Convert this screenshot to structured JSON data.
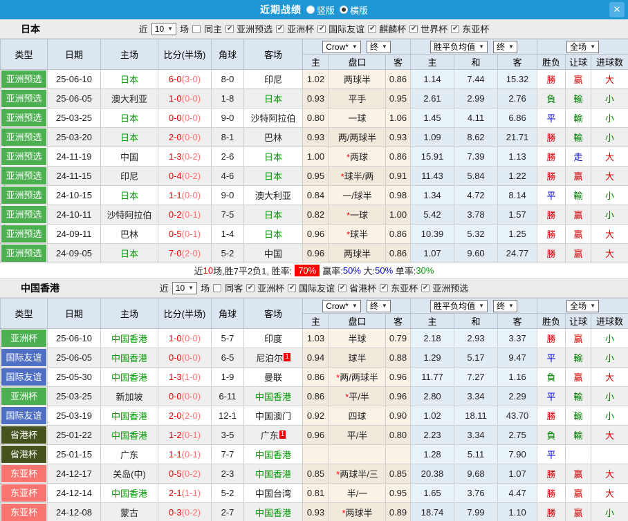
{
  "colors": {
    "titlebar": "#1e97d4",
    "badge_green": "#4cb050",
    "badge_blue": "#4e6fc4",
    "badge_olive": "#47531e",
    "badge_salmon": "#fa7470",
    "team_green": "#009900",
    "score_red": "#e60000",
    "half_red": "#ff7373",
    "win": "#d40000",
    "lose": "#008000",
    "draw": "#0000cc",
    "summary_highlight": "#ff0000"
  },
  "titlebar": {
    "title": "近期战绩",
    "vertical_label": "竖版",
    "horizontal_label": "横版",
    "close_glyph": "✕"
  },
  "controls": {
    "near": "近",
    "matches": "场"
  },
  "table_header": {
    "type": "类型",
    "date": "日期",
    "home": "主场",
    "score": "比分(半场)",
    "corner": "角球",
    "away": "客场",
    "crow_label": "Crow*",
    "final_label": "终",
    "avg_label": "胜平负均值",
    "fullmatch_label": "全场",
    "sub": [
      "主",
      "盘口",
      "客",
      "主",
      "和",
      "客",
      "胜负",
      "让球",
      "进球数"
    ]
  },
  "sections": [
    {
      "team": "日本",
      "count": "10",
      "same_label": "同主",
      "same_checked": false,
      "competitions": [
        "亚洲预选",
        "亚洲杯",
        "国际友谊",
        "麒麟杯",
        "世界杯",
        "东亚杯"
      ],
      "rows": [
        {
          "type": "亚洲预选",
          "tc": "g",
          "date": "25-06-10",
          "home": "日本",
          "hg": 1,
          "score": "6-0",
          "half": "(3-0)",
          "corner": "8-0",
          "away": "印尼",
          "ag": 0,
          "sup": "",
          "o1": "1.02",
          "hc": "两球半",
          "o2": "0.86",
          "m1": "1.14",
          "m2": "7.44",
          "m3": "15.32",
          "r1": "勝",
          "r2": "赢",
          "r3": "大"
        },
        {
          "type": "亚洲预选",
          "tc": "g",
          "date": "25-06-05",
          "home": "澳大利亚",
          "hg": 0,
          "score": "1-0",
          "half": "(0-0)",
          "corner": "1-8",
          "away": "日本",
          "ag": 1,
          "sup": "",
          "o1": "0.93",
          "hc": "平手",
          "o2": "0.95",
          "m1": "2.61",
          "m2": "2.99",
          "m3": "2.76",
          "r1": "負",
          "r2": "輸",
          "r3": "小"
        },
        {
          "type": "亚洲预选",
          "tc": "g",
          "date": "25-03-25",
          "home": "日本",
          "hg": 1,
          "score": "0-0",
          "half": "(0-0)",
          "corner": "9-0",
          "away": "沙特阿拉伯",
          "ag": 0,
          "sup": "",
          "o1": "0.80",
          "hc": "一球",
          "o2": "1.06",
          "m1": "1.45",
          "m2": "4.11",
          "m3": "6.86",
          "r1": "平",
          "r2": "輸",
          "r3": "小"
        },
        {
          "type": "亚洲预选",
          "tc": "g",
          "date": "25-03-20",
          "home": "日本",
          "hg": 1,
          "score": "2-0",
          "half": "(0-0)",
          "corner": "8-1",
          "away": "巴林",
          "ag": 0,
          "sup": "",
          "o1": "0.93",
          "hc": "两/两球半",
          "o2": "0.93",
          "m1": "1.09",
          "m2": "8.62",
          "m3": "21.71",
          "r1": "勝",
          "r2": "輸",
          "r3": "小"
        },
        {
          "type": "亚洲预选",
          "tc": "g",
          "date": "24-11-19",
          "home": "中国",
          "hg": 0,
          "score": "1-3",
          "half": "(0-2)",
          "corner": "2-6",
          "away": "日本",
          "ag": 1,
          "sup": "",
          "o1": "1.00",
          "hc": "*两球",
          "o2": "0.86",
          "m1": "15.91",
          "m2": "7.39",
          "m3": "1.13",
          "r1": "勝",
          "r2": "走",
          "r3": "大"
        },
        {
          "type": "亚洲预选",
          "tc": "g",
          "date": "24-11-15",
          "home": "印尼",
          "hg": 0,
          "score": "0-4",
          "half": "(0-2)",
          "corner": "4-6",
          "away": "日本",
          "ag": 1,
          "sup": "",
          "o1": "0.95",
          "hc": "*球半/两",
          "o2": "0.91",
          "m1": "11.43",
          "m2": "5.84",
          "m3": "1.22",
          "r1": "勝",
          "r2": "赢",
          "r3": "大"
        },
        {
          "type": "亚洲预选",
          "tc": "g",
          "date": "24-10-15",
          "home": "日本",
          "hg": 1,
          "score": "1-1",
          "half": "(0-0)",
          "corner": "9-0",
          "away": "澳大利亚",
          "ag": 0,
          "sup": "",
          "o1": "0.84",
          "hc": "一/球半",
          "o2": "0.98",
          "m1": "1.34",
          "m2": "4.72",
          "m3": "8.14",
          "r1": "平",
          "r2": "輸",
          "r3": "小"
        },
        {
          "type": "亚洲预选",
          "tc": "g",
          "date": "24-10-11",
          "home": "沙特阿拉伯",
          "hg": 0,
          "score": "0-2",
          "half": "(0-1)",
          "corner": "7-5",
          "away": "日本",
          "ag": 1,
          "sup": "",
          "o1": "0.82",
          "hc": "*一球",
          "o2": "1.00",
          "m1": "5.42",
          "m2": "3.78",
          "m3": "1.57",
          "r1": "勝",
          "r2": "赢",
          "r3": "小"
        },
        {
          "type": "亚洲预选",
          "tc": "g",
          "date": "24-09-11",
          "home": "巴林",
          "hg": 0,
          "score": "0-5",
          "half": "(0-1)",
          "corner": "1-4",
          "away": "日本",
          "ag": 1,
          "sup": "",
          "o1": "0.96",
          "hc": "*球半",
          "o2": "0.86",
          "m1": "10.39",
          "m2": "5.32",
          "m3": "1.25",
          "r1": "勝",
          "r2": "赢",
          "r3": "大"
        },
        {
          "type": "亚洲预选",
          "tc": "g",
          "date": "24-09-05",
          "home": "日本",
          "hg": 1,
          "score": "7-0",
          "half": "(2-0)",
          "corner": "5-2",
          "away": "中国",
          "ag": 0,
          "sup": "",
          "o1": "0.96",
          "hc": "两球半",
          "o2": "0.86",
          "m1": "1.07",
          "m2": "9.60",
          "m3": "24.77",
          "r1": "勝",
          "r2": "赢",
          "r3": "大"
        }
      ],
      "summary": [
        {
          "t": "近",
          "c": ""
        },
        {
          "t": "10",
          "c": "r"
        },
        {
          "t": "场,胜7平2负1, 胜率:",
          "c": ""
        },
        {
          "t": "70%",
          "c": "hl"
        },
        {
          "t": "赢率:",
          "c": ""
        },
        {
          "t": "50%",
          "c": "b"
        },
        {
          "t": " 大:",
          "c": ""
        },
        {
          "t": "50%",
          "c": "b"
        },
        {
          "t": " 单率:",
          "c": ""
        },
        {
          "t": "30%",
          "c": "g"
        }
      ]
    },
    {
      "team": "中国香港",
      "count": "10",
      "same_label": "同客",
      "same_checked": false,
      "competitions": [
        "亚洲杯",
        "国际友谊",
        "省港杯",
        "东亚杯",
        "亚洲预选"
      ],
      "rows": [
        {
          "type": "亚洲杯",
          "tc": "g",
          "date": "25-06-10",
          "home": "中国香港",
          "hg": 1,
          "score": "1-0",
          "half": "(0-0)",
          "corner": "5-7",
          "away": "印度",
          "ag": 0,
          "sup": "",
          "o1": "1.03",
          "hc": "半球",
          "o2": "0.79",
          "m1": "2.18",
          "m2": "2.93",
          "m3": "3.37",
          "r1": "勝",
          "r2": "赢",
          "r3": "小"
        },
        {
          "type": "国际友谊",
          "tc": "b",
          "date": "25-06-05",
          "home": "中国香港",
          "hg": 1,
          "score": "0-0",
          "half": "(0-0)",
          "corner": "6-5",
          "away": "尼泊尔",
          "ag": 0,
          "sup": "1",
          "o1": "0.94",
          "hc": "球半",
          "o2": "0.88",
          "m1": "1.29",
          "m2": "5.17",
          "m3": "9.47",
          "r1": "平",
          "r2": "輸",
          "r3": "小"
        },
        {
          "type": "国际友谊",
          "tc": "b",
          "date": "25-05-30",
          "home": "中国香港",
          "hg": 1,
          "score": "1-3",
          "half": "(1-0)",
          "corner": "1-9",
          "away": "曼联",
          "ag": 0,
          "sup": "",
          "o1": "0.86",
          "hc": "*两/两球半",
          "o2": "0.96",
          "m1": "11.77",
          "m2": "7.27",
          "m3": "1.16",
          "r1": "負",
          "r2": "赢",
          "r3": "大"
        },
        {
          "type": "亚洲杯",
          "tc": "g",
          "date": "25-03-25",
          "home": "新加坡",
          "hg": 0,
          "score": "0-0",
          "half": "(0-0)",
          "corner": "6-11",
          "away": "中国香港",
          "ag": 1,
          "sup": "",
          "o1": "0.86",
          "hc": "*平/半",
          "o2": "0.96",
          "m1": "2.80",
          "m2": "3.34",
          "m3": "2.29",
          "r1": "平",
          "r2": "輸",
          "r3": "小"
        },
        {
          "type": "国际友谊",
          "tc": "b",
          "date": "25-03-19",
          "home": "中国香港",
          "hg": 1,
          "score": "2-0",
          "half": "(2-0)",
          "corner": "12-1",
          "away": "中国澳门",
          "ag": 0,
          "sup": "",
          "o1": "0.92",
          "hc": "四球",
          "o2": "0.90",
          "m1": "1.02",
          "m2": "18.11",
          "m3": "43.70",
          "r1": "勝",
          "r2": "輸",
          "r3": "小"
        },
        {
          "type": "省港杯",
          "tc": "o",
          "date": "25-01-22",
          "home": "中国香港",
          "hg": 1,
          "score": "1-2",
          "half": "(0-1)",
          "corner": "3-5",
          "away": "广东",
          "ag": 0,
          "sup": "1",
          "o1": "0.96",
          "hc": "平/半",
          "o2": "0.80",
          "m1": "2.23",
          "m2": "3.34",
          "m3": "2.75",
          "r1": "負",
          "r2": "輸",
          "r3": "大"
        },
        {
          "type": "省港杯",
          "tc": "o",
          "date": "25-01-15",
          "home": "广东",
          "hg": 0,
          "score": "1-1",
          "half": "(0-1)",
          "corner": "7-7",
          "away": "中国香港",
          "ag": 1,
          "sup": "",
          "o1": "",
          "hc": "",
          "o2": "",
          "m1": "1.28",
          "m2": "5.11",
          "m3": "7.90",
          "r1": "平",
          "r2": "",
          "r3": ""
        },
        {
          "type": "东亚杯",
          "tc": "s",
          "date": "24-12-17",
          "home": "关岛(中)",
          "hg": 0,
          "score": "0-5",
          "half": "(0-2)",
          "corner": "2-3",
          "away": "中国香港",
          "ag": 1,
          "sup": "",
          "o1": "0.85",
          "hc": "*两球半/三",
          "o2": "0.85",
          "m1": "20.38",
          "m2": "9.68",
          "m3": "1.07",
          "r1": "勝",
          "r2": "赢",
          "r3": "大"
        },
        {
          "type": "东亚杯",
          "tc": "s",
          "date": "24-12-14",
          "home": "中国香港",
          "hg": 1,
          "score": "2-1",
          "half": "(1-1)",
          "corner": "5-2",
          "away": "中国台湾",
          "ag": 0,
          "sup": "",
          "o1": "0.81",
          "hc": "半/一",
          "o2": "0.95",
          "m1": "1.65",
          "m2": "3.76",
          "m3": "4.47",
          "r1": "勝",
          "r2": "赢",
          "r3": "大"
        },
        {
          "type": "东亚杯",
          "tc": "s",
          "date": "24-12-08",
          "home": "蒙古",
          "hg": 0,
          "score": "0-3",
          "half": "(0-2)",
          "corner": "2-7",
          "away": "中国香港",
          "ag": 1,
          "sup": "",
          "o1": "0.93",
          "hc": "*两球半",
          "o2": "0.89",
          "m1": "18.74",
          "m2": "7.99",
          "m3": "1.10",
          "r1": "勝",
          "r2": "赢",
          "r3": "小"
        }
      ]
    }
  ]
}
